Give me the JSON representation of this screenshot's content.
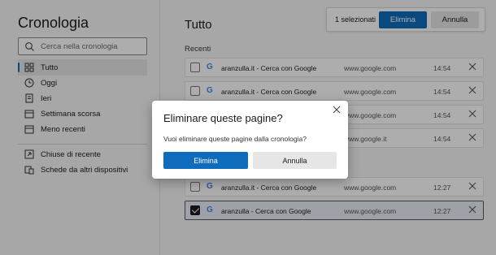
{
  "sidebar": {
    "title": "Cronologia",
    "search_placeholder": "Cerca nella cronologia",
    "items": [
      {
        "label": "Tutto",
        "icon": "grid-icon"
      },
      {
        "label": "Oggi",
        "icon": "clock-icon"
      },
      {
        "label": "Ieri",
        "icon": "document-icon"
      },
      {
        "label": "Settimana scorsa",
        "icon": "calendar-icon"
      },
      {
        "label": "Meno recenti",
        "icon": "calendar-icon"
      },
      {
        "label": "Chiuse di recente",
        "icon": "closed-tab-icon"
      },
      {
        "label": "Schede da altri dispositivi",
        "icon": "devices-icon"
      }
    ]
  },
  "main": {
    "title": "Tutto",
    "section_recent": "Recenti",
    "rows": [
      {
        "title": "aranzulla.it - Cerca con Google",
        "url": "www.google.com",
        "time": "14:54",
        "checked": false
      },
      {
        "title": "aranzulla.it - Cerca con Google",
        "url": "www.google.com",
        "time": "14:54",
        "checked": false
      },
      {
        "title": "",
        "url": "www.google.com",
        "time": "14:54",
        "checked": false
      },
      {
        "title": "",
        "url": "www.google.it",
        "time": "14:54",
        "checked": false
      },
      {
        "title": "aranzulla.it - Cerca con Google",
        "url": "www.google.com",
        "time": "12:27",
        "checked": false
      },
      {
        "title": "aranzulla - Cerca con Google",
        "url": "www.google.com",
        "time": "12:27",
        "checked": true
      }
    ]
  },
  "toolbar": {
    "selected_label": "1 selezionati",
    "delete_label": "Elimina",
    "cancel_label": "Annulla"
  },
  "dialog": {
    "title": "Eliminare queste pagine?",
    "message": "Vuoi eliminare queste pagine dalla cronologia?",
    "delete_label": "Elimina",
    "cancel_label": "Annulla"
  },
  "colors": {
    "accent": "#0f6cbd",
    "overlay": "rgba(0,0,0,0.32)"
  }
}
